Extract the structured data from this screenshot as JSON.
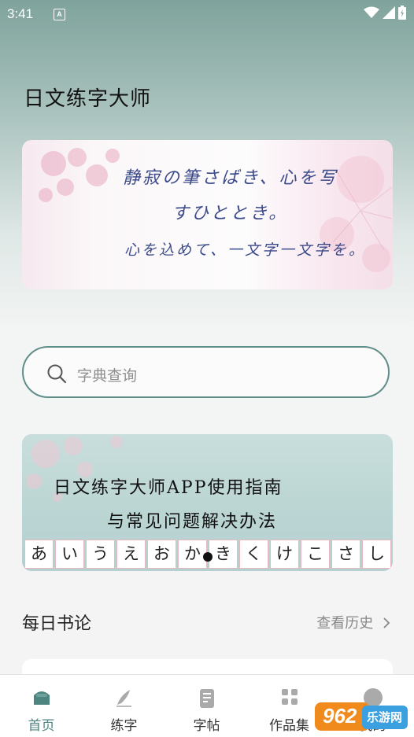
{
  "status": {
    "time": "3:41",
    "a_badge": "A"
  },
  "app": {
    "title": "日文练字大师"
  },
  "banner": {
    "lines": [
      "静寂の筆さばき、心を写",
      "すひととき。",
      "心を込めて、一文字一文字を。"
    ]
  },
  "search": {
    "placeholder": "字典查询",
    "icon": "search-icon"
  },
  "guide": {
    "line1": "日文练字大师APP使用指南",
    "line2": "与常见问题解决办法",
    "kana": [
      "あ",
      "い",
      "う",
      "え",
      "お",
      "か",
      "き",
      "く",
      "け",
      "こ",
      "さ",
      "し"
    ]
  },
  "section": {
    "title": "每日书论",
    "history_label": "查看历史"
  },
  "tabs": [
    {
      "label": "首页",
      "icon": "home-icon",
      "active": true
    },
    {
      "label": "练字",
      "icon": "brush-icon",
      "active": false
    },
    {
      "label": "字帖",
      "icon": "copybook-icon",
      "active": false
    },
    {
      "label": "作品集",
      "icon": "grid-icon",
      "active": false
    },
    {
      "label": "我的",
      "icon": "profile-icon",
      "active": false
    }
  ],
  "watermark": {
    "text": "962",
    "sub": "乐游网"
  },
  "colors": {
    "accent": "#4f8580",
    "search_border": "#5f8e89",
    "banner_text": "#3b4a8a"
  }
}
